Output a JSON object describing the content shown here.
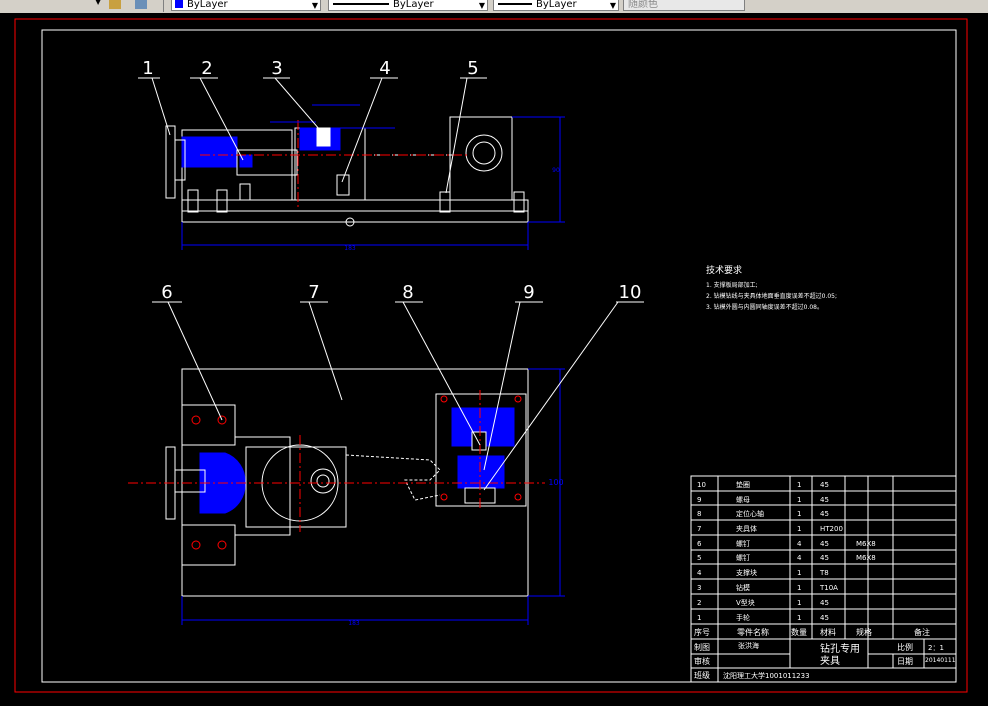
{
  "toolbar": {
    "layer_value": "ByLayer",
    "linetype_value": "ByLayer",
    "lineweight_value": "ByLayer",
    "plotstyle_value": "随颜色"
  },
  "colors": {
    "background": "#000000",
    "geometry": "#ffffff",
    "dimension": "#0000ff",
    "centerline": "#ff0000",
    "hatch": "#0000ff",
    "frame_red": "#ff0000"
  },
  "balloons": {
    "b1": "1",
    "b2": "2",
    "b3": "3",
    "b4": "4",
    "b5": "5",
    "b6": "6",
    "b7": "7",
    "b8": "8",
    "b9": "9",
    "b10": "10"
  },
  "dimensions": {
    "top_length": "183",
    "top_height": "90",
    "bottom_length": "183",
    "bottom_height": "100"
  },
  "tech_req": {
    "title": "技术要求",
    "line1": "1. 支撑板局部加工;",
    "line2": "2. 钻模钻线与夹具体地面垂直度误差不超过0.05;",
    "line3": "3. 钻模外圆与内圆同轴度误差不超过0.08。"
  },
  "bom": {
    "rows": [
      {
        "no": "10",
        "name": "垫圈",
        "qty": "1",
        "material": "45",
        "spec": ""
      },
      {
        "no": "9",
        "name": "螺母",
        "qty": "1",
        "material": "45",
        "spec": ""
      },
      {
        "no": "8",
        "name": "定位心轴",
        "qty": "1",
        "material": "45",
        "spec": ""
      },
      {
        "no": "7",
        "name": "夹具体",
        "qty": "1",
        "material": "HT200",
        "spec": ""
      },
      {
        "no": "6",
        "name": "螺钉",
        "qty": "4",
        "material": "45",
        "spec": "M6X8"
      },
      {
        "no": "5",
        "name": "螺钉",
        "qty": "4",
        "material": "45",
        "spec": "M6X8"
      },
      {
        "no": "4",
        "name": "支撑块",
        "qty": "1",
        "material": "T8",
        "spec": ""
      },
      {
        "no": "3",
        "name": "钻模",
        "qty": "1",
        "material": "T10A",
        "spec": ""
      },
      {
        "no": "2",
        "name": "V型块",
        "qty": "1",
        "material": "45",
        "spec": ""
      },
      {
        "no": "1",
        "name": "手轮",
        "qty": "1",
        "material": "45",
        "spec": ""
      }
    ],
    "header": {
      "no": "序号",
      "name": "零件名称",
      "qty": "数量",
      "material": "材料",
      "spec": "规格",
      "note": "备注"
    }
  },
  "title_block": {
    "drawn_label": "制图",
    "drawn_name": "张洪海",
    "checked_label": "审核",
    "class_label": "班级",
    "school": "沈阳理工大学1001011233",
    "title_line1": "钻孔专用",
    "title_line2": "夹具",
    "scale_label": "比例",
    "scale_value": "2：1",
    "date_label": "日期",
    "date_value": "20140111"
  }
}
